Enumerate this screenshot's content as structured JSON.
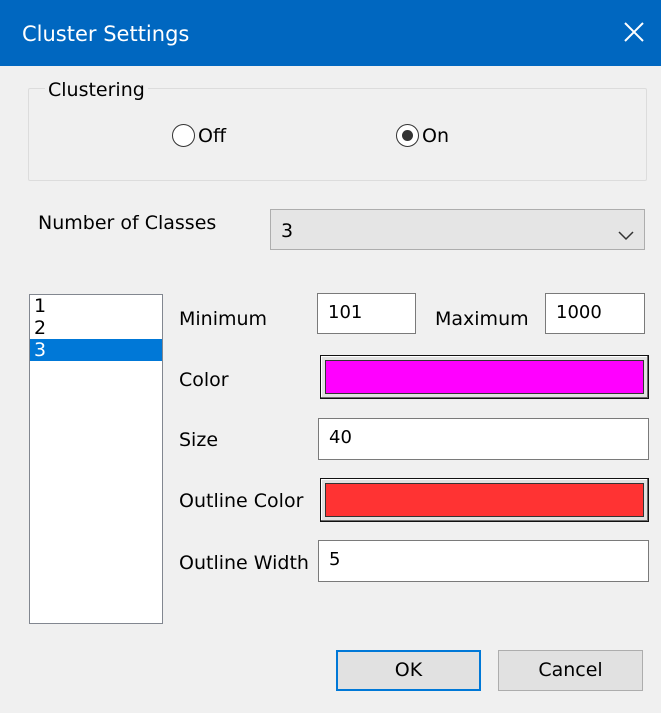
{
  "window": {
    "title": "Cluster Settings",
    "close_icon": "close-icon"
  },
  "clustering": {
    "legend": "Clustering",
    "options": [
      {
        "label": "Off",
        "checked": false
      },
      {
        "label": "On",
        "checked": true
      }
    ]
  },
  "classes": {
    "label": "Number of Classes",
    "selected": "3",
    "list": [
      "1",
      "2",
      "3"
    ],
    "selected_index": 2
  },
  "fields": {
    "minimum_label": "Minimum",
    "minimum_value": "101",
    "maximum_label": "Maximum",
    "maximum_value": "1000",
    "color_label": "Color",
    "color_value": "#ff00ff",
    "size_label": "Size",
    "size_value": "40",
    "outline_color_label": "Outline Color",
    "outline_color_value": "#ff3333",
    "outline_width_label": "Outline Width",
    "outline_width_value": "5"
  },
  "buttons": {
    "ok": "OK",
    "cancel": "Cancel"
  },
  "colors": {
    "titlebar": "#0067c0",
    "selection": "#0078d7",
    "dialog_bg": "#f0f0f0"
  }
}
